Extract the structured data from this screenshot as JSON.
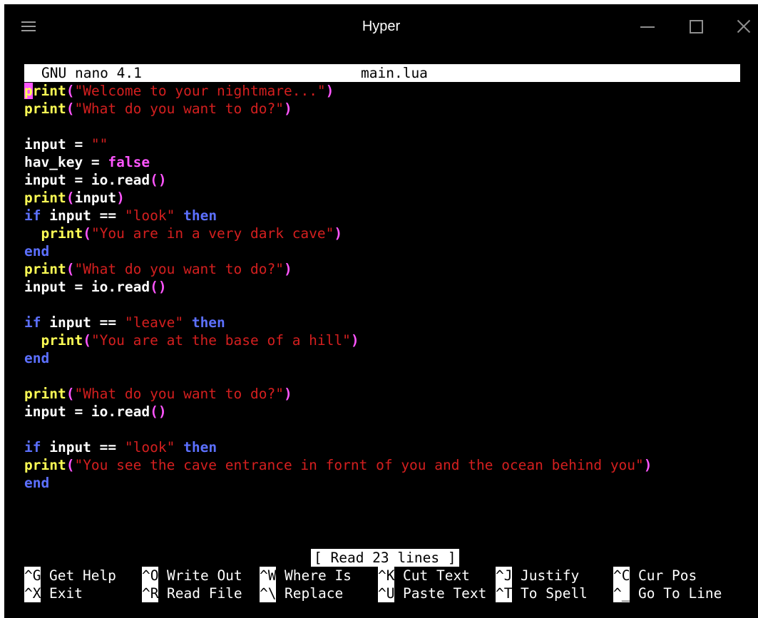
{
  "window": {
    "title": "Hyper"
  },
  "nano": {
    "version": "GNU nano 4.1",
    "filename": "main.lua",
    "status": "[ Read 23 lines ]"
  },
  "colors": {
    "function": "#ffff55",
    "string": "#d41f1f",
    "keyword": "#5c70ff",
    "literal": "#ff55ff",
    "identifier": "#ffffff"
  },
  "code_lines": [
    [
      [
        "fn",
        "print"
      ],
      [
        "paren",
        "("
      ],
      [
        "str",
        "\"Welcome to your nightmare...\""
      ],
      [
        "paren",
        ")"
      ]
    ],
    [
      [
        "fn",
        "print"
      ],
      [
        "paren",
        "("
      ],
      [
        "str",
        "\"What do you want to do?\""
      ],
      [
        "paren",
        ")"
      ]
    ],
    [],
    [
      [
        "id",
        "input = "
      ],
      [
        "str",
        "\"\""
      ]
    ],
    [
      [
        "id",
        "hav_key = "
      ],
      [
        "lit",
        "false"
      ]
    ],
    [
      [
        "id",
        "input = io.read"
      ],
      [
        "paren",
        "()"
      ]
    ],
    [
      [
        "fn",
        "print"
      ],
      [
        "paren",
        "("
      ],
      [
        "id",
        "input"
      ],
      [
        "paren",
        ")"
      ]
    ],
    [
      [
        "kw",
        "if"
      ],
      [
        "id",
        " input == "
      ],
      [
        "str",
        "\"look\""
      ],
      [
        "id",
        " "
      ],
      [
        "kw",
        "then"
      ]
    ],
    [
      [
        "id",
        "  "
      ],
      [
        "fn",
        "print"
      ],
      [
        "paren",
        "("
      ],
      [
        "str",
        "\"You are in a very dark cave\""
      ],
      [
        "paren",
        ")"
      ]
    ],
    [
      [
        "kw",
        "end"
      ]
    ],
    [
      [
        "fn",
        "print"
      ],
      [
        "paren",
        "("
      ],
      [
        "str",
        "\"What do you want to do?\""
      ],
      [
        "paren",
        ")"
      ]
    ],
    [
      [
        "id",
        "input = io.read"
      ],
      [
        "paren",
        "()"
      ]
    ],
    [],
    [
      [
        "kw",
        "if"
      ],
      [
        "id",
        " input == "
      ],
      [
        "str",
        "\"leave\""
      ],
      [
        "id",
        " "
      ],
      [
        "kw",
        "then"
      ]
    ],
    [
      [
        "id",
        "  "
      ],
      [
        "fn",
        "print"
      ],
      [
        "paren",
        "("
      ],
      [
        "str",
        "\"You are at the base of a hill\""
      ],
      [
        "paren",
        ")"
      ]
    ],
    [
      [
        "kw",
        "end"
      ]
    ],
    [],
    [
      [
        "fn",
        "print"
      ],
      [
        "paren",
        "("
      ],
      [
        "str",
        "\"What do you want to do?\""
      ],
      [
        "paren",
        ")"
      ]
    ],
    [
      [
        "id",
        "input = io.read"
      ],
      [
        "paren",
        "()"
      ]
    ],
    [],
    [
      [
        "kw",
        "if"
      ],
      [
        "id",
        " input == "
      ],
      [
        "str",
        "\"look\""
      ],
      [
        "id",
        " "
      ],
      [
        "kw",
        "then"
      ]
    ],
    [
      [
        "fn",
        "print"
      ],
      [
        "paren",
        "("
      ],
      [
        "str",
        "\"You see the cave entrance in fornt of you and the ocean behind you\""
      ],
      [
        "paren",
        ")"
      ]
    ],
    [
      [
        "kw",
        "end"
      ]
    ]
  ],
  "shortcuts_row1": [
    {
      "key": "^G",
      "label": "Get Help",
      "name": "shortcut-get-help"
    },
    {
      "key": "^O",
      "label": "Write Out",
      "name": "shortcut-write-out"
    },
    {
      "key": "^W",
      "label": "Where Is",
      "name": "shortcut-where-is"
    },
    {
      "key": "^K",
      "label": "Cut Text",
      "name": "shortcut-cut-text"
    },
    {
      "key": "^J",
      "label": "Justify",
      "name": "shortcut-justify"
    },
    {
      "key": "^C",
      "label": "Cur Pos",
      "name": "shortcut-cur-pos"
    }
  ],
  "shortcuts_row2": [
    {
      "key": "^X",
      "label": "Exit",
      "name": "shortcut-exit"
    },
    {
      "key": "^R",
      "label": "Read File",
      "name": "shortcut-read-file"
    },
    {
      "key": "^\\",
      "label": "Replace",
      "name": "shortcut-replace"
    },
    {
      "key": "^U",
      "label": "Paste Text",
      "name": "shortcut-paste-text"
    },
    {
      "key": "^T",
      "label": "To Spell",
      "name": "shortcut-to-spell"
    },
    {
      "key": "^_",
      "label": "Go To Line",
      "name": "shortcut-go-to-line"
    }
  ]
}
